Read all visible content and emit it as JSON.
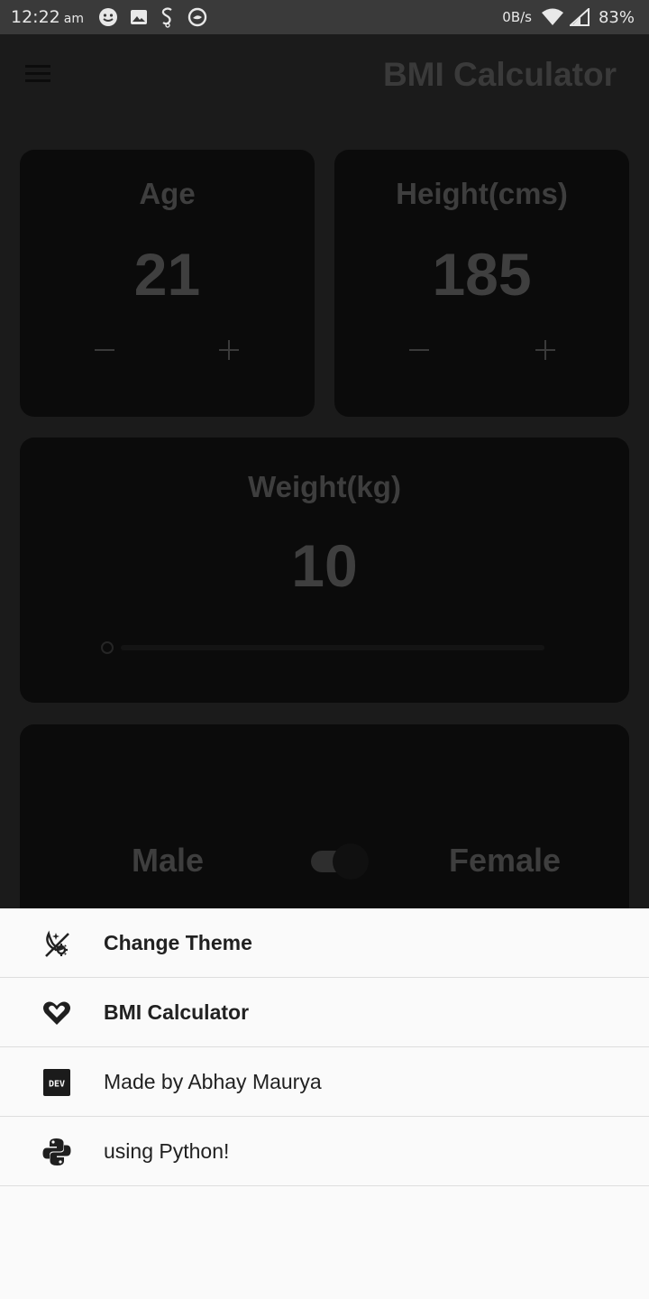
{
  "status_bar": {
    "time": "12:22",
    "ampm": "am",
    "network_speed": "0B/s",
    "battery": "83%"
  },
  "app_bar": {
    "title": "BMI Calculator"
  },
  "age_card": {
    "label": "Age",
    "value": "21",
    "minus": "−",
    "plus": "+"
  },
  "height_card": {
    "label": "Height(cms)",
    "value": "185",
    "minus": "−",
    "plus": "+"
  },
  "weight_card": {
    "label": "Weight(kg)",
    "value": "10",
    "slider_level": 0.0
  },
  "gender_card": {
    "left_label": "Male",
    "right_label": "Female",
    "toggle_on": true
  },
  "sheet": {
    "items": [
      {
        "icon": "theme-icon",
        "label": "Change Theme",
        "bold": true
      },
      {
        "icon": "heart-icon",
        "label": "BMI Calculator",
        "bold": true
      },
      {
        "icon": "dev-icon",
        "label": "Made by Abhay Maurya",
        "bold": false
      },
      {
        "icon": "python-icon",
        "label": "using Python!",
        "bold": false
      }
    ]
  }
}
